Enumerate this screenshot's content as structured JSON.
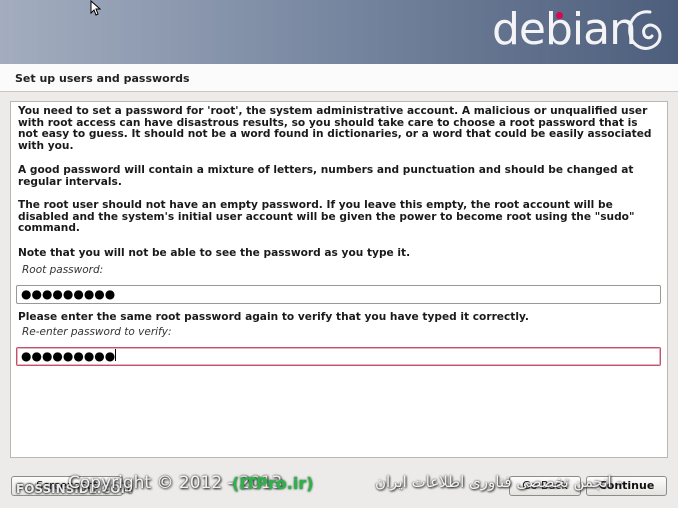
{
  "banner": {
    "logo_text": "debian"
  },
  "page": {
    "title": "Set up users and passwords"
  },
  "content": {
    "paragraph1": "You need to set a password for 'root', the system administrative account. A malicious or unqualified user with root access can have disastrous results, so you should take care to choose a root password that is not easy to guess. It should not be a word found in dictionaries, or a word that could be easily associated with you.",
    "paragraph2": "A good password will contain a mixture of letters, numbers and punctuation and should be changed at regular intervals.",
    "paragraph3": "The root user should not have an empty password. If you leave this empty, the root account will be disabled and the system's initial user account will be given the power to become root using the \"sudo\" command.",
    "paragraph4": "Note that you will not be able to see the password as you type it.",
    "root_password_label": "Root password:",
    "root_password_value": "●●●●●●●●●",
    "verify_instruction": "Please enter the same root password again to verify that you have typed it correctly.",
    "verify_label": "Re-enter password to verify:",
    "verify_value": "●●●●●●●●●"
  },
  "buttons": {
    "screenshot": "Screenshot",
    "back": "Go Back",
    "continue": "Continue"
  },
  "watermark": {
    "left": "FOSSINSIDE.COM",
    "copyright": "Copyright © 2012 - 2013",
    "site": "(ITPro.ir)",
    "persian": "- انجمن تخصصی فناوری اطلاعات ایران"
  }
}
